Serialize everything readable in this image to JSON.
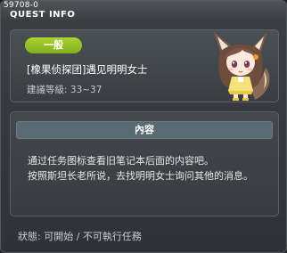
{
  "window": {
    "quest_id": "59708-0",
    "title": "QUEST INFO"
  },
  "quest": {
    "category": "一般",
    "title": "[橡果侦探团]遇见明明女士",
    "recommended_level_label": "建議等級",
    "recommended_level_sep": ":",
    "recommended_level_range": "33~37",
    "npc_portrait_icon": "fox-girl-npc-icon"
  },
  "content": {
    "header": "內容",
    "lines": [
      "通过任务图标查看旧笔记本后面的内容吧。",
      "按照斯坦长老所说，去找明明女士询问其他的消息。"
    ]
  },
  "status": {
    "label": "狀態",
    "sep": ":",
    "value": "可開始 / 不可執行任務"
  },
  "colors": {
    "badge_green": "#8cbf22",
    "content_header_bg": "#5a6a72",
    "window_bg": "#33373b"
  }
}
